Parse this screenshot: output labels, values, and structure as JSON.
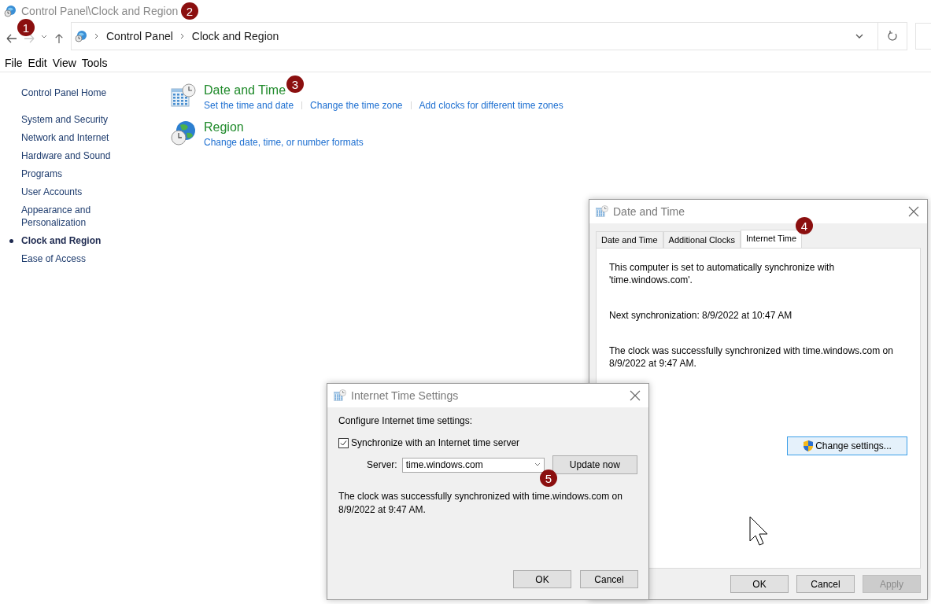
{
  "window": {
    "title": "Control Panel\\Clock and Region"
  },
  "nav": {
    "back_disabled": false,
    "forward_disabled": true
  },
  "address": {
    "crumbs": [
      "Control Panel",
      "Clock and Region"
    ]
  },
  "menu": [
    "File",
    "Edit",
    "View",
    "Tools"
  ],
  "sidebar": {
    "home": "Control Panel Home",
    "items": [
      {
        "label": "System and Security",
        "selected": false
      },
      {
        "label": "Network and Internet",
        "selected": false
      },
      {
        "label": "Hardware and Sound",
        "selected": false
      },
      {
        "label": "Programs",
        "selected": false
      },
      {
        "label": "User Accounts",
        "selected": false
      },
      {
        "label": "Appearance and Personalization",
        "selected": false
      },
      {
        "label": "Clock and Region",
        "selected": true
      },
      {
        "label": "Ease of Access",
        "selected": false
      }
    ]
  },
  "categories": [
    {
      "kind": "datetime",
      "title": "Date and Time",
      "links": [
        "Set the time and date",
        "Change the time zone",
        "Add clocks for different time zones"
      ]
    },
    {
      "kind": "region",
      "title": "Region",
      "links": [
        "Change date, time, or number formats"
      ]
    }
  ],
  "date_time_dialog": {
    "title": "Date and Time",
    "tabs": [
      {
        "label": "Date and Time",
        "selected": false
      },
      {
        "label": "Additional Clocks",
        "selected": false
      },
      {
        "label": "Internet Time",
        "selected": true
      }
    ],
    "paragraphs": [
      "This computer is set to automatically synchronize with 'time.windows.com'.",
      "Next synchronization: 8/9/2022 at 10:47 AM",
      "The clock was successfully synchronized with time.windows.com on 8/9/2022 at 9:47 AM."
    ],
    "change_button": "Change settings...",
    "buttons": [
      {
        "label": "OK",
        "disabled": false
      },
      {
        "label": "Cancel",
        "disabled": false
      },
      {
        "label": "Apply",
        "disabled": true
      }
    ]
  },
  "internet_time_dialog": {
    "title": "Internet Time Settings",
    "heading": "Configure Internet time settings:",
    "sync": {
      "label": "Synchronize with an Internet time server",
      "checked": true
    },
    "server_label": "Server:",
    "server_value": "time.windows.com",
    "update_button": "Update now",
    "status": "The clock was successfully synchronized with time.windows.com on 8/9/2022 at 9:47 AM.",
    "buttons": [
      "OK",
      "Cancel"
    ]
  },
  "annotations": [
    "1",
    "2",
    "3",
    "4",
    "5"
  ]
}
